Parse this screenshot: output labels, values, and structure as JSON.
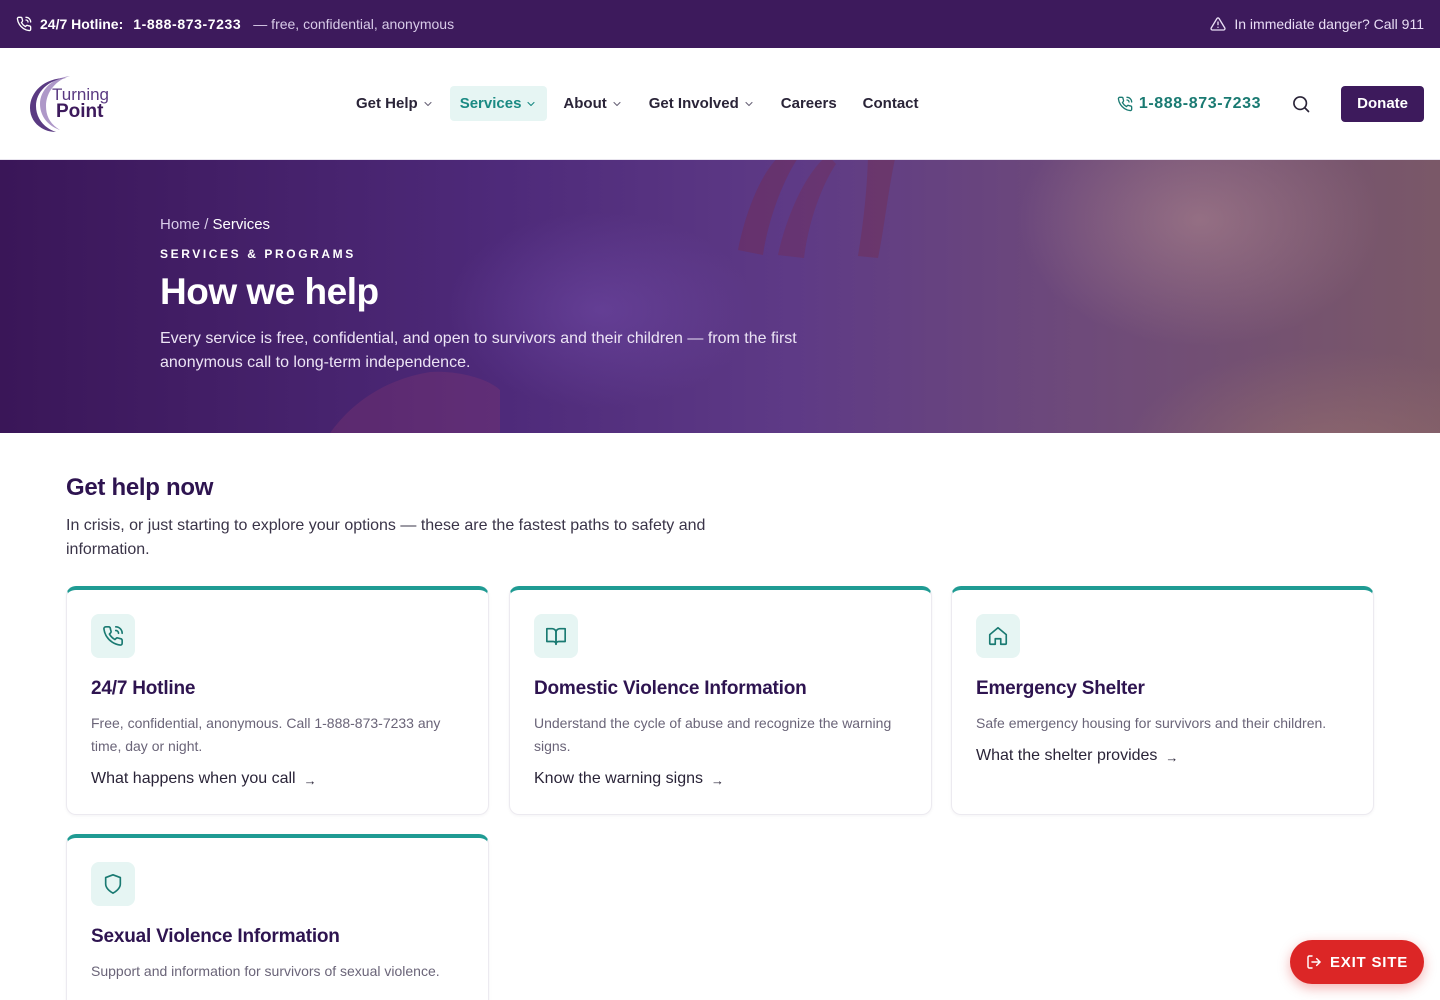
{
  "colors": {
    "brand_purple": "#3d1a5c",
    "accent_teal": "#1f9b93",
    "exit_red": "#dc2626"
  },
  "topbar": {
    "phone_icon": "phone-icon",
    "hotline_label": "24/7 Hotline:",
    "hotline_number": "1-888-873-7233",
    "hotline_note": "— free, confidential, anonymous",
    "warning_icon": "warning-triangle-icon",
    "danger_text": "In immediate danger? Call 911"
  },
  "header": {
    "logo": {
      "line1": "Turning",
      "line2": "Point"
    },
    "nav": [
      {
        "label": "Get Help",
        "dropdown": true,
        "active": false
      },
      {
        "label": "Services",
        "dropdown": true,
        "active": true
      },
      {
        "label": "About",
        "dropdown": true,
        "active": false
      },
      {
        "label": "Get Involved",
        "dropdown": true,
        "active": false
      },
      {
        "label": "Careers",
        "dropdown": false,
        "active": false
      },
      {
        "label": "Contact",
        "dropdown": false,
        "active": false
      }
    ],
    "phone": "1-888-873-7233",
    "search_icon": "search-icon",
    "donate_label": "Donate"
  },
  "hero": {
    "breadcrumb_home": "Home",
    "breadcrumb_sep": "/",
    "breadcrumb_current": "Services",
    "eyebrow": "SERVICES & PROGRAMS",
    "title": "How we help",
    "subtitle": "Every service is free, confidential, and open to survivors and their children — from the first anonymous call to long-term independence."
  },
  "get_help": {
    "title": "Get help now",
    "subtitle": "In crisis, or just starting to explore your options — these are the fastest paths to safety and information."
  },
  "cards": [
    {
      "icon": "phone-icon",
      "title": "24/7 Hotline",
      "description": "Free, confidential, anonymous. Call 1-888-873-7233 any time, day or night.",
      "link": "What happens when you call",
      "arrow": "→"
    },
    {
      "icon": "book-icon",
      "title": "Domestic Violence Information",
      "description": "Understand the cycle of abuse and recognize the warning signs.",
      "link": "Know the warning signs",
      "arrow": "→"
    },
    {
      "icon": "home-icon",
      "title": "Emergency Shelter",
      "description": "Safe emergency housing for survivors and their children.",
      "link": "What the shelter provides",
      "arrow": "→"
    },
    {
      "icon": "shield-icon",
      "title": "Sexual Violence Information",
      "description": "Support and information for survivors of sexual violence.",
      "link": "",
      "arrow": ""
    }
  ],
  "exit": {
    "icon": "exit-icon",
    "label": "EXIT SITE"
  }
}
